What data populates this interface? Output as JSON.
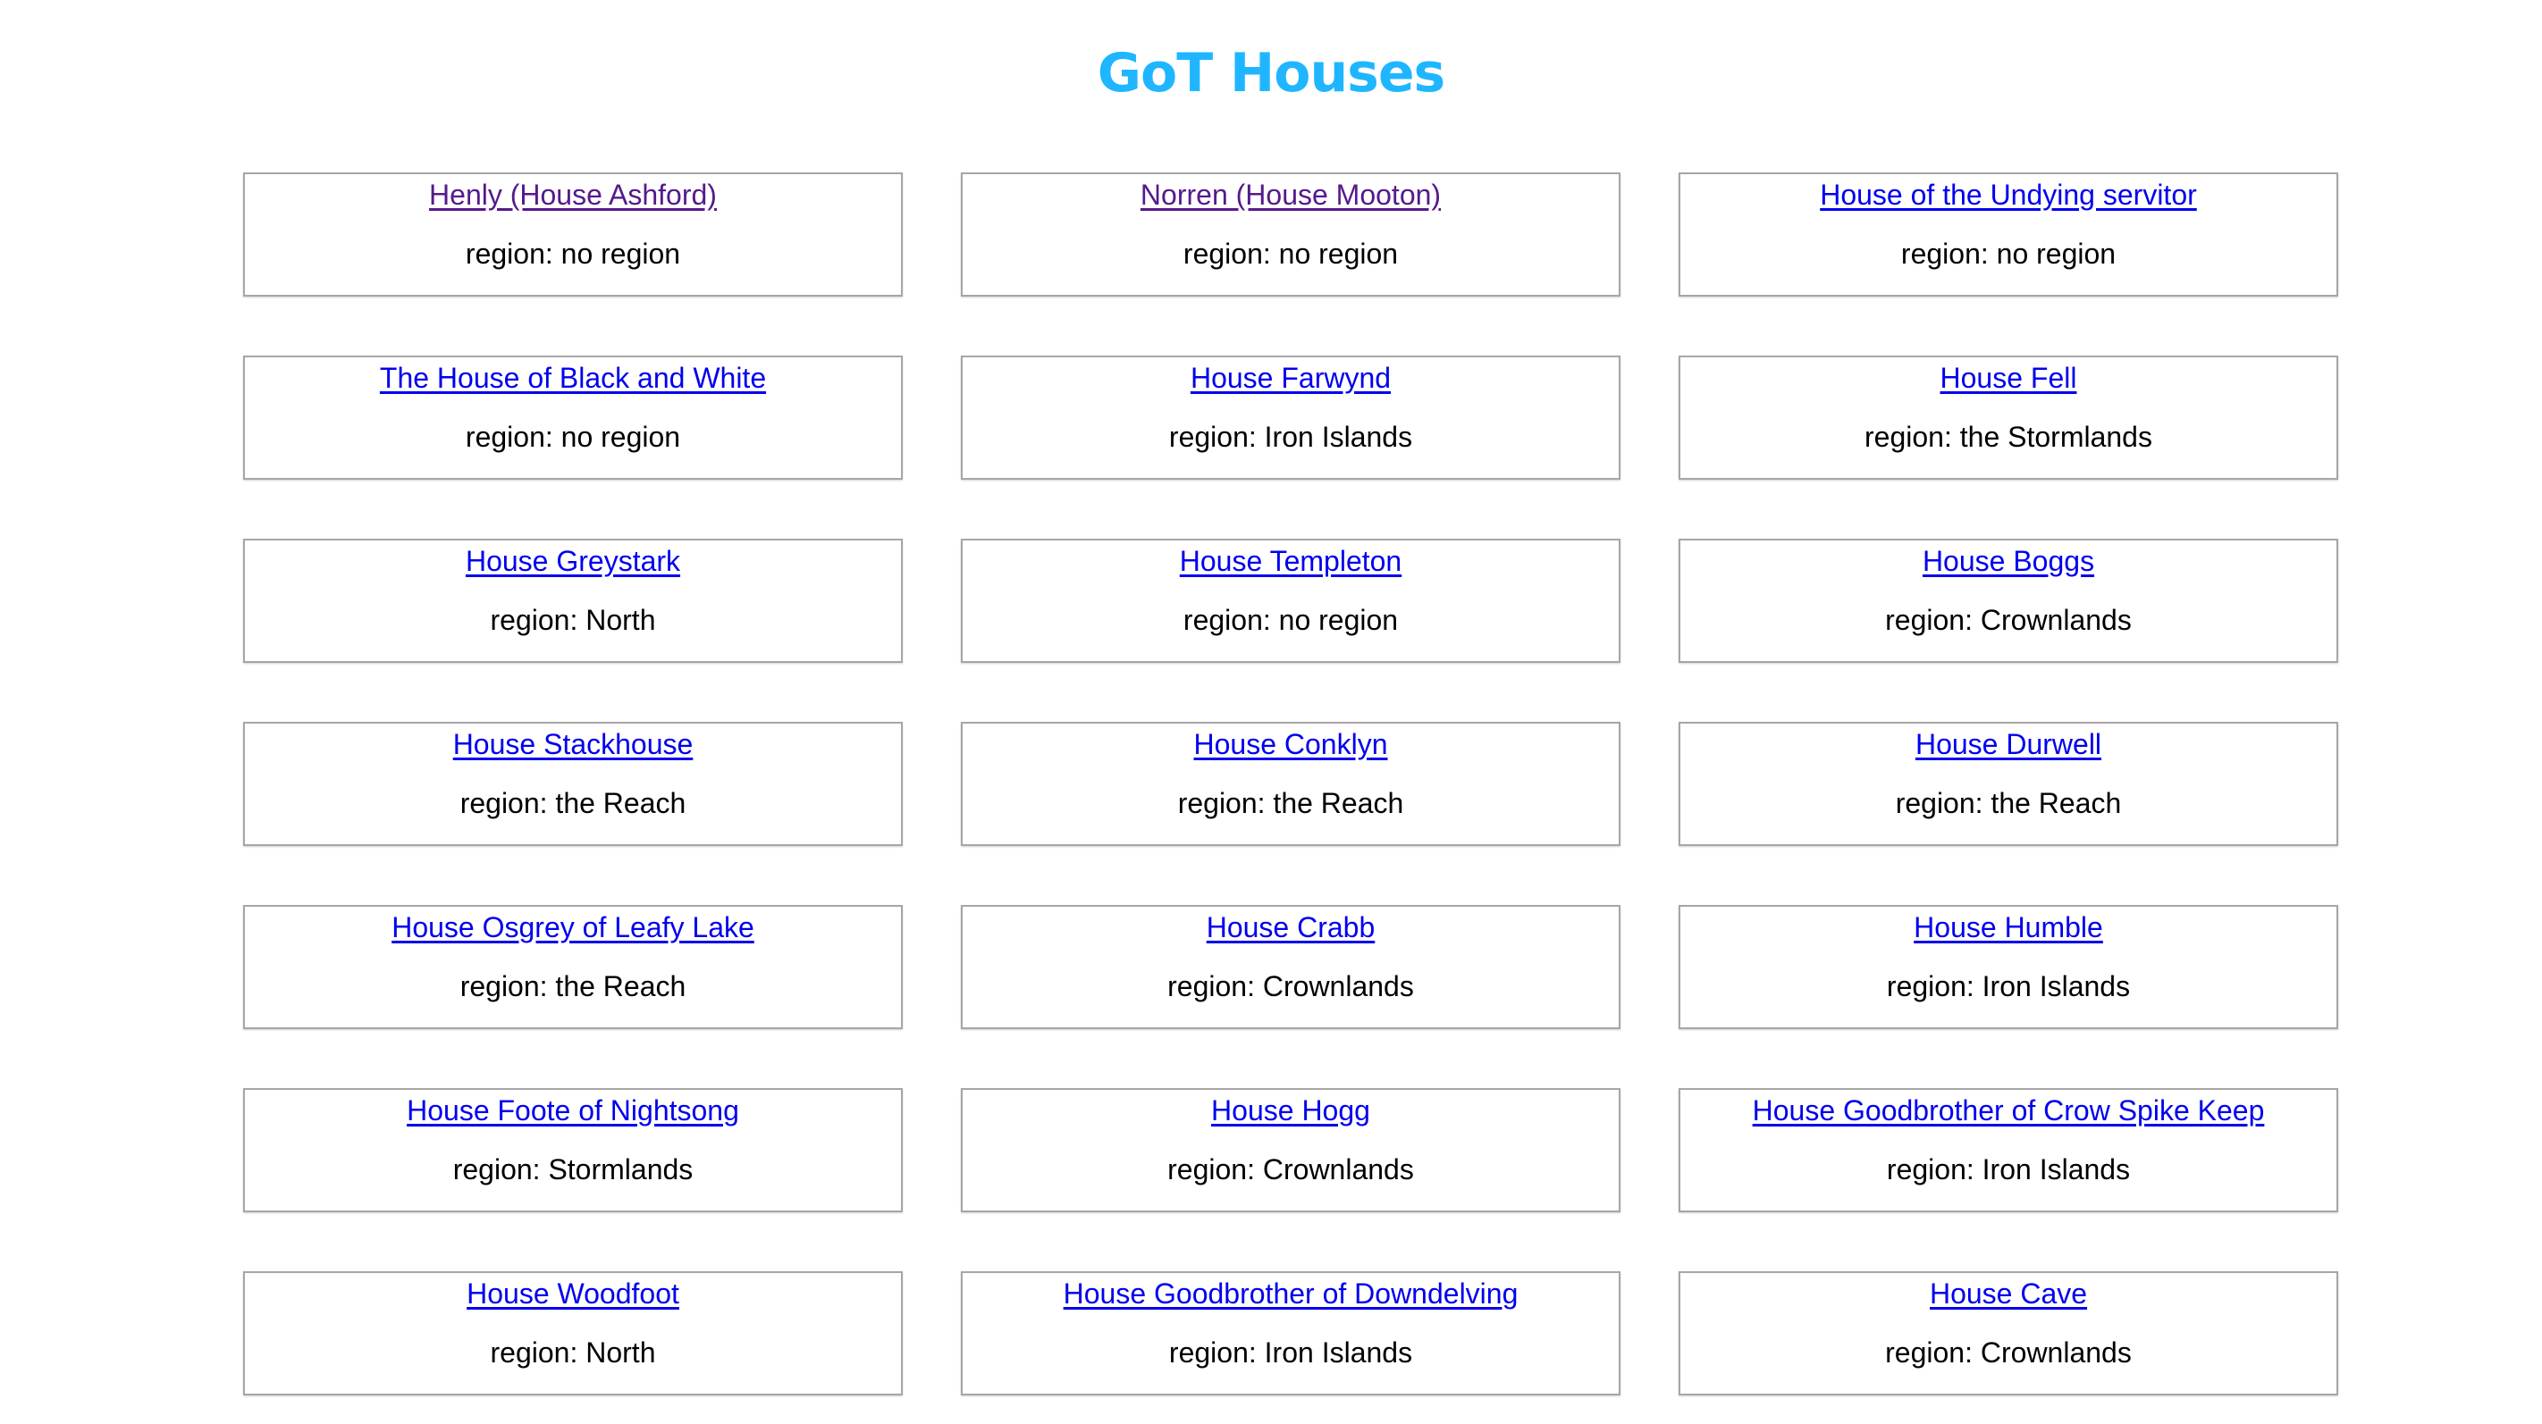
{
  "page": {
    "title": "GoT Houses",
    "title_color": "#1fb6ff"
  },
  "colors": {
    "link": "#0000ee",
    "link_visited": "#551a8b",
    "card_border": "#a6a6a6",
    "text": "#000000"
  },
  "houses": [
    {
      "name": "Henly (House Ashford)",
      "region": "region: no region",
      "visited": true
    },
    {
      "name": "Norren (House Mooton)",
      "region": "region: no region",
      "visited": true
    },
    {
      "name": "House of the Undying servitor",
      "region": "region: no region",
      "visited": false
    },
    {
      "name": "The House of Black and White",
      "region": "region: no region",
      "visited": false
    },
    {
      "name": "House Farwynd",
      "region": "region: Iron Islands",
      "visited": false
    },
    {
      "name": "House Fell",
      "region": "region: the Stormlands",
      "visited": false
    },
    {
      "name": "House Greystark",
      "region": "region: North",
      "visited": false
    },
    {
      "name": "House Templeton",
      "region": "region: no region",
      "visited": false
    },
    {
      "name": "House Boggs",
      "region": "region: Crownlands",
      "visited": false
    },
    {
      "name": "House Stackhouse",
      "region": "region: the Reach",
      "visited": false
    },
    {
      "name": "House Conklyn",
      "region": "region: the Reach",
      "visited": false
    },
    {
      "name": "House Durwell",
      "region": "region: the Reach",
      "visited": false
    },
    {
      "name": "House Osgrey of Leafy Lake",
      "region": "region: the Reach",
      "visited": false
    },
    {
      "name": "House Crabb",
      "region": "region: Crownlands",
      "visited": false
    },
    {
      "name": "House Humble",
      "region": "region: Iron Islands",
      "visited": false
    },
    {
      "name": "House Foote of Nightsong",
      "region": "region: Stormlands",
      "visited": false
    },
    {
      "name": "House Hogg",
      "region": "region: Crownlands",
      "visited": false
    },
    {
      "name": "House Goodbrother of Crow Spike Keep",
      "region": "region: Iron Islands",
      "visited": false
    },
    {
      "name": "House Woodfoot",
      "region": "region: North",
      "visited": false
    },
    {
      "name": "House Goodbrother of Downdelving",
      "region": "region: Iron Islands",
      "visited": false
    },
    {
      "name": "House Cave",
      "region": "region: Crownlands",
      "visited": false
    }
  ]
}
